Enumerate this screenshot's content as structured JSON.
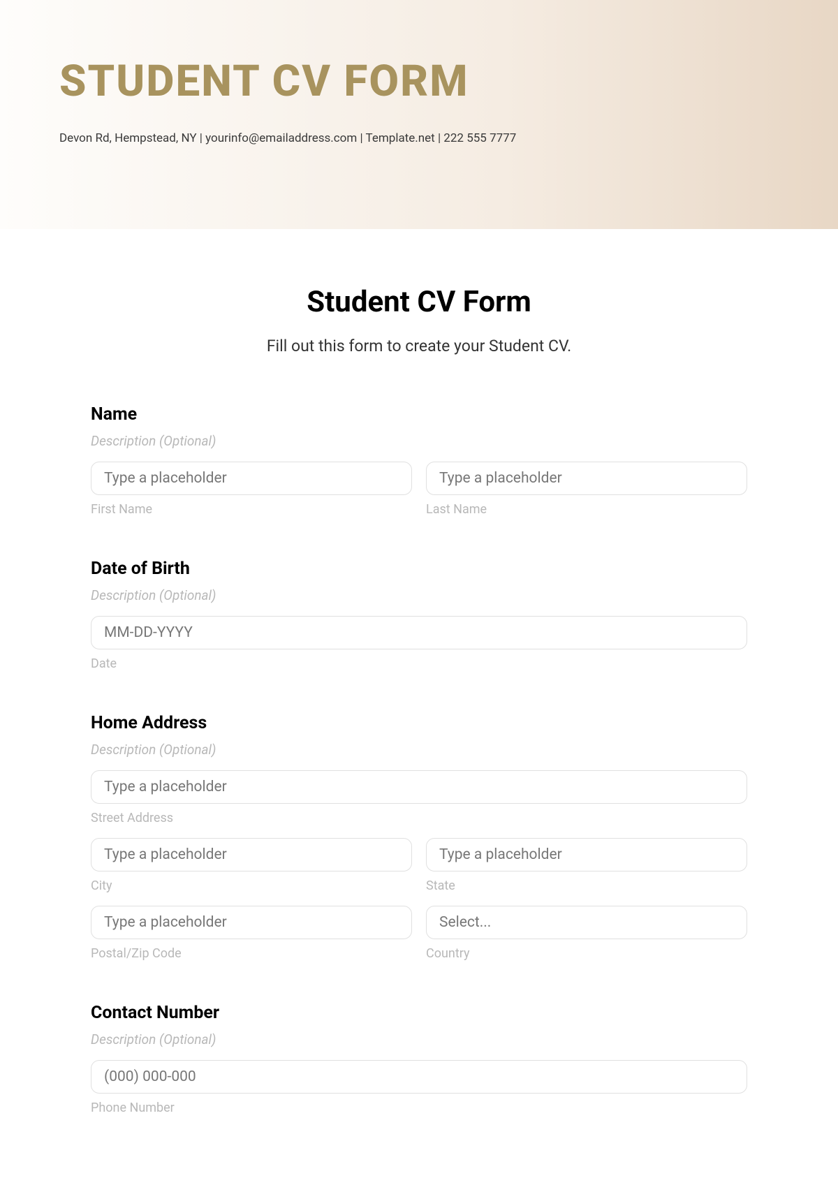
{
  "header": {
    "title": "STUDENT CV FORM",
    "contact": "Devon Rd, Hempstead, NY | yourinfo@emailaddress.com | Template.net | 222 555 7777"
  },
  "form": {
    "heading": "Student CV Form",
    "subtitle": "Fill out this form to create your Student CV."
  },
  "sections": {
    "name": {
      "label": "Name",
      "desc": "Description (Optional)",
      "first_placeholder": "Type a placeholder",
      "first_sublabel": "First Name",
      "last_placeholder": "Type a placeholder",
      "last_sublabel": "Last Name"
    },
    "dob": {
      "label": "Date of Birth",
      "desc": "Description (Optional)",
      "date_placeholder": "MM-DD-YYYY",
      "date_sublabel": "Date"
    },
    "address": {
      "label": "Home Address",
      "desc": "Description (Optional)",
      "street_placeholder": "Type a placeholder",
      "street_sublabel": "Street Address",
      "city_placeholder": "Type a placeholder",
      "city_sublabel": "City",
      "state_placeholder": "Type a placeholder",
      "state_sublabel": "State",
      "postal_placeholder": "Type a placeholder",
      "postal_sublabel": "Postal/Zip Code",
      "country_placeholder": "Select...",
      "country_sublabel": "Country"
    },
    "contact": {
      "label": "Contact Number",
      "desc": "Description (Optional)",
      "phone_placeholder": "(000) 000-000",
      "phone_sublabel": "Phone Number"
    }
  }
}
